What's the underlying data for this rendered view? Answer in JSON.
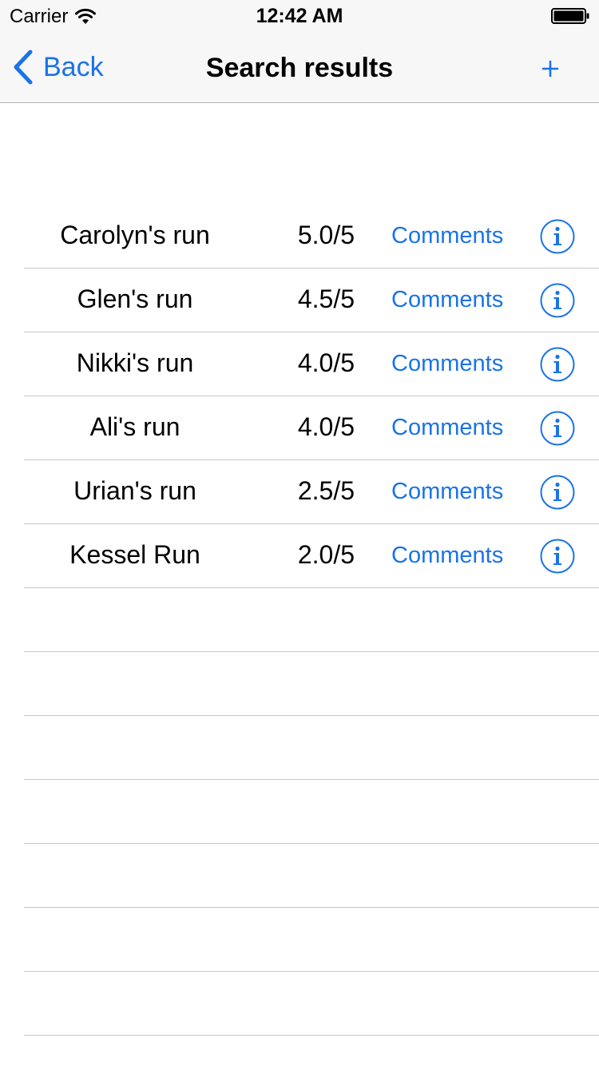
{
  "status_bar": {
    "carrier": "Carrier",
    "time": "12:42 AM",
    "icons": [
      "wifi-icon",
      "battery-icon"
    ]
  },
  "nav": {
    "back_label": "Back",
    "title": "Search results",
    "add_icon": "plus-icon"
  },
  "colors": {
    "accent": "#1a73e8",
    "separator": "#c8c7cc",
    "bar_background": "#f7f7f7"
  },
  "results": [
    {
      "name": "Carolyn's run",
      "rating": "5.0/5",
      "comments_label": "Comments"
    },
    {
      "name": "Glen's run",
      "rating": "4.5/5",
      "comments_label": "Comments"
    },
    {
      "name": "Nikki's run",
      "rating": "4.0/5",
      "comments_label": "Comments"
    },
    {
      "name": "Ali's run",
      "rating": "4.0/5",
      "comments_label": "Comments"
    },
    {
      "name": "Urian's run",
      "rating": "2.5/5",
      "comments_label": "Comments"
    },
    {
      "name": "Kessel Run",
      "rating": "2.0/5",
      "comments_label": "Comments"
    }
  ]
}
